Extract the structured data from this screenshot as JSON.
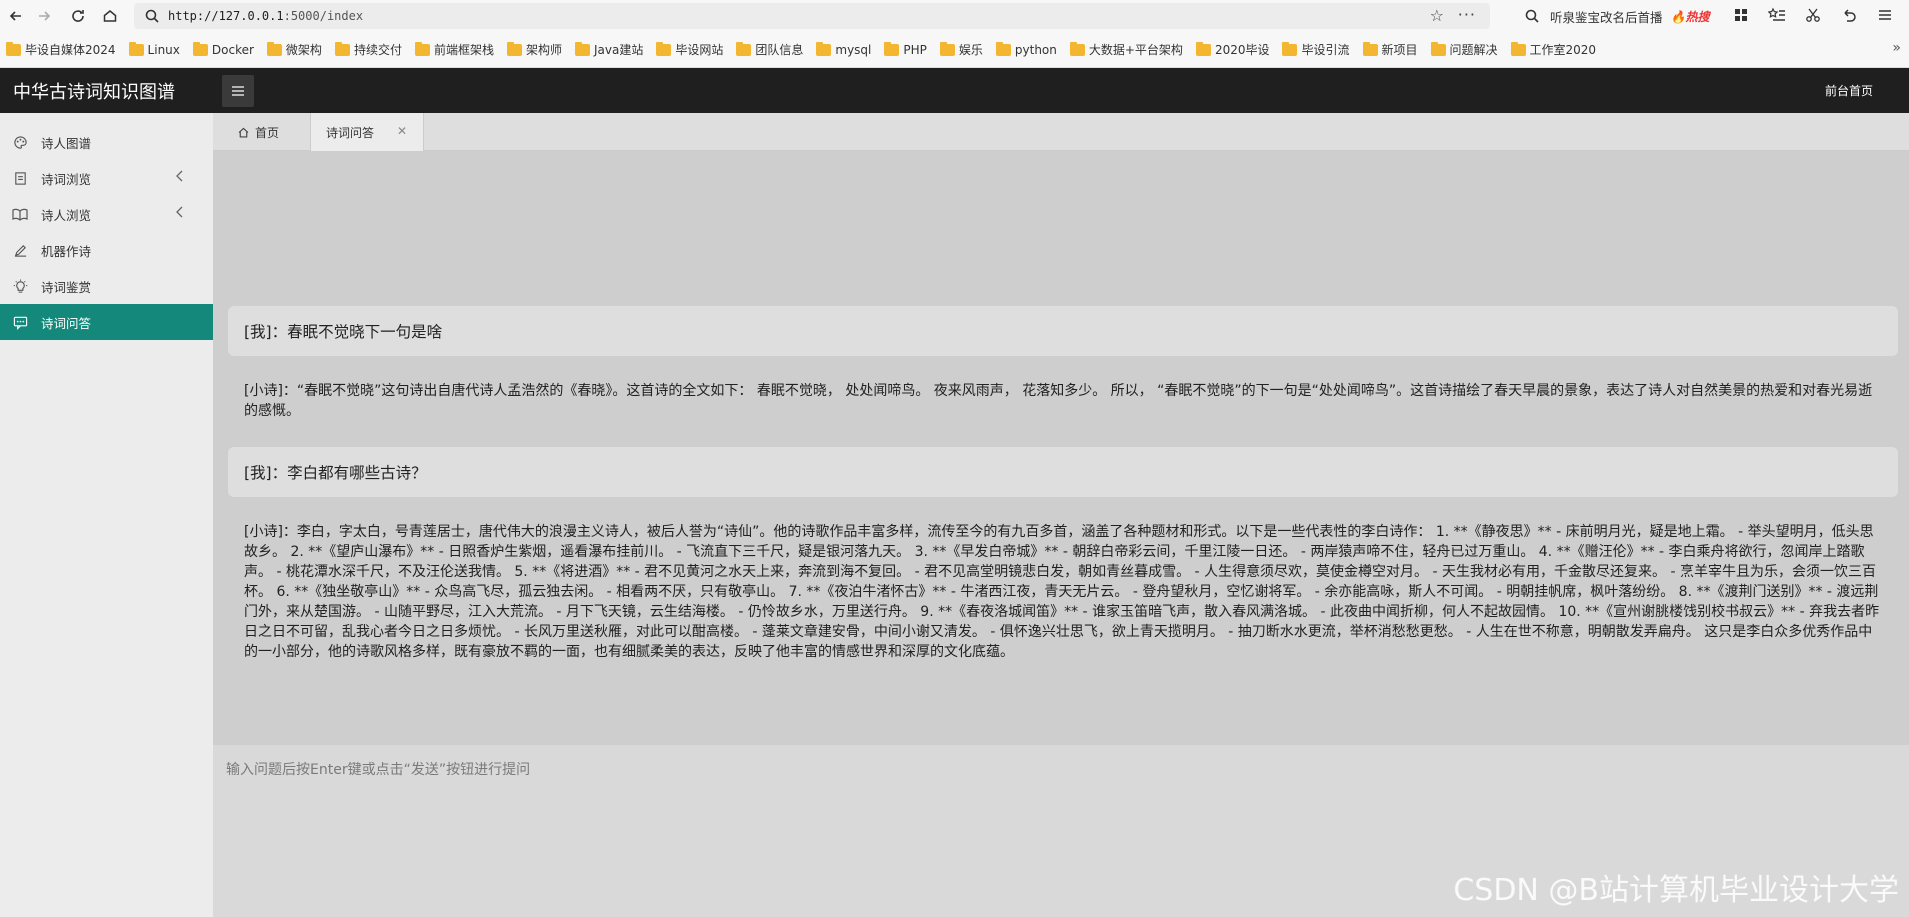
{
  "browser": {
    "url_prefix": "http://127.0.0.1",
    "url_suffix": ":5000/index",
    "hot_search_text": "听泉鉴宝改名后首播",
    "hot_badge": "热搜",
    "bookmarks": [
      "毕设自媒体2024",
      "Linux",
      "Docker",
      "微架构",
      "持续交付",
      "前端框架栈",
      "架构师",
      "Java建站",
      "毕设网站",
      "团队信息",
      "mysql",
      "PHP",
      "娱乐",
      "python",
      "大数据+平台架构",
      "2020毕设",
      "毕设引流",
      "新项目",
      "问题解决",
      "工作室2020"
    ]
  },
  "header": {
    "app_title": "中华古诗词知识图谱",
    "front_link": "前台首页"
  },
  "sidebar": {
    "items": [
      {
        "label": "诗人图谱",
        "icon": "palette-icon",
        "has_arrow": false
      },
      {
        "label": "诗词浏览",
        "icon": "document-icon",
        "has_arrow": true
      },
      {
        "label": "诗人浏览",
        "icon": "book-icon",
        "has_arrow": true
      },
      {
        "label": "机器作诗",
        "icon": "pencil-icon",
        "has_arrow": false
      },
      {
        "label": "诗词鉴赏",
        "icon": "lightbulb-icon",
        "has_arrow": false
      },
      {
        "label": "诗词问答",
        "icon": "chat-icon",
        "has_arrow": false,
        "active": true
      }
    ],
    "active_color": "#14887a"
  },
  "tabs": {
    "home_label": "首页",
    "qa_label": "诗词问答",
    "close_symbol": "✕"
  },
  "chat": {
    "q1": "[我]：春眠不觉晓下一句是啥",
    "a1": "[小诗]：“春眠不觉晓”这句诗出自唐代诗人孟浩然的《春晓》。这首诗的全文如下： 春眠不觉晓， 处处闻啼鸟。 夜来风雨声， 花落知多少。 所以， “春眠不觉晓”的下一句是“处处闻啼鸟”。这首诗描绘了春天早晨的景象，表达了诗人对自然美景的热爱和对春光易逝的感慨。",
    "q2": "[我]：李白都有哪些古诗？",
    "a2": "[小诗]：李白，字太白，号青莲居士，唐代伟大的浪漫主义诗人，被后人誉为“诗仙”。他的诗歌作品丰富多样，流传至今的有九百多首，涵盖了各种题材和形式。以下是一些代表性的李白诗作： 1. **《静夜思》** - 床前明月光，疑是地上霜。 - 举头望明月，低头思故乡。 2. **《望庐山瀑布》** - 日照香炉生紫烟，遥看瀑布挂前川。 - 飞流直下三千尺，疑是银河落九天。 3. **《早发白帝城》** - 朝辞白帝彩云间，千里江陵一日还。 - 两岸猿声啼不住，轻舟已过万重山。 4. **《赠汪伦》** - 李白乘舟将欲行，忽闻岸上踏歌声。 - 桃花潭水深千尺，不及汪伦送我情。 5. **《将进酒》** - 君不见黄河之水天上来，奔流到海不复回。 - 君不见高堂明镜悲白发，朝如青丝暮成雪。 - 人生得意须尽欢，莫使金樽空对月。 - 天生我材必有用，千金散尽还复来。 - 烹羊宰牛且为乐，会须一饮三百杯。 6. **《独坐敬亭山》** - 众鸟高飞尽，孤云独去闲。 - 相看两不厌，只有敬亭山。 7. **《夜泊牛渚怀古》** - 牛渚西江夜，青天无片云。 - 登舟望秋月，空忆谢将军。 - 余亦能高咏，斯人不可闻。 - 明朝挂帆席，枫叶落纷纷。 8. **《渡荆门送别》** - 渡远荆门外，来从楚国游。 - 山随平野尽，江入大荒流。 - 月下飞天镜，云生结海楼。 - 仍怜故乡水，万里送行舟。 9. **《春夜洛城闻笛》** - 谁家玉笛暗飞声，散入春风满洛城。 - 此夜曲中闻折柳，何人不起故园情。 10. **《宣州谢朓楼饯别校书叔云》** - 弃我去者昨日之日不可留，乱我心者今日之日多烦忧。 - 长风万里送秋雁，对此可以酣高楼。 - 蓬莱文章建安骨，中间小谢又清发。 - 俱怀逸兴壮思飞，欲上青天揽明月。 - 抽刀断水水更流，举杯消愁愁更愁。 - 人生在世不称意，明朝散发弄扁舟。 这只是李白众多优秀作品中的一小部分，他的诗歌风格多样，既有豪放不羁的一面，也有细腻柔美的表达，反映了他丰富的情感世界和深厚的文化底蕴。"
  },
  "input": {
    "placeholder": "输入问题后按Enter键或点击“发送”按钮进行提问"
  },
  "watermark": "CSDN @B站计算机毕业设计大学"
}
